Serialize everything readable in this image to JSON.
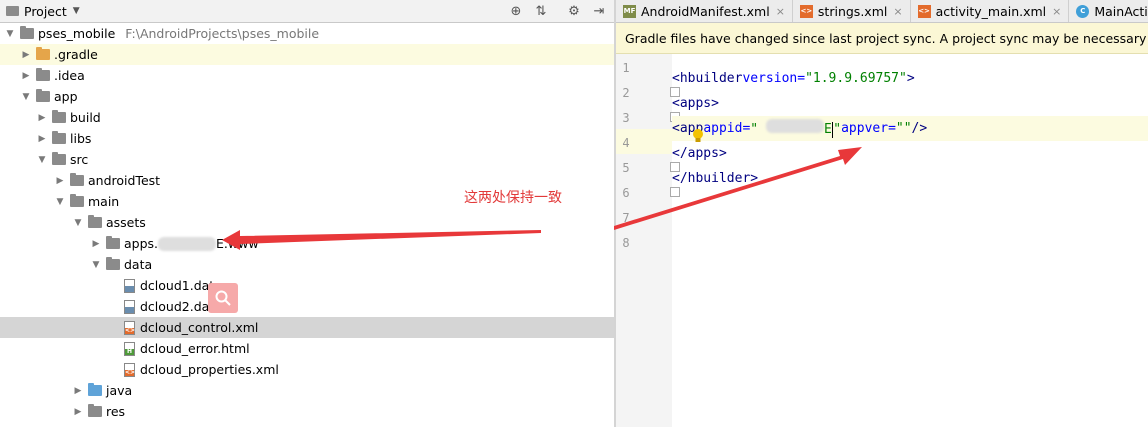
{
  "project_panel": {
    "title": "Project",
    "tools": [
      "target-icon",
      "collapse-icon",
      "gear-icon",
      "hide-icon"
    ]
  },
  "tree": [
    {
      "label": "pses_mobile",
      "path": "F:\\AndroidProjects\\pses_mobile",
      "depth": 0,
      "expanded": true,
      "icon": "module",
      "arrow": true
    },
    {
      "label": ".gradle",
      "depth": 1,
      "expanded": false,
      "icon": "folder-orange",
      "arrow": true
    },
    {
      "label": ".idea",
      "depth": 1,
      "expanded": false,
      "icon": "folder",
      "arrow": true
    },
    {
      "label": "app",
      "depth": 1,
      "expanded": true,
      "icon": "folder-module",
      "arrow": true
    },
    {
      "label": "build",
      "depth": 2,
      "expanded": false,
      "icon": "folder",
      "arrow": true
    },
    {
      "label": "libs",
      "depth": 2,
      "expanded": false,
      "icon": "folder",
      "arrow": true
    },
    {
      "label": "src",
      "depth": 2,
      "expanded": true,
      "icon": "folder",
      "arrow": true
    },
    {
      "label": "androidTest",
      "depth": 3,
      "expanded": false,
      "icon": "folder",
      "arrow": true
    },
    {
      "label": "main",
      "depth": 3,
      "expanded": true,
      "icon": "folder",
      "arrow": true
    },
    {
      "label": "assets",
      "depth": 4,
      "expanded": true,
      "icon": "folder-res",
      "arrow": true
    },
    {
      "label": "apps.",
      "suffix": "E.www",
      "depth": 5,
      "expanded": false,
      "icon": "folder",
      "arrow": true,
      "blurred": true
    },
    {
      "label": "data",
      "depth": 5,
      "expanded": true,
      "icon": "folder",
      "arrow": true
    },
    {
      "label": "dcloud1.dat",
      "depth": 6,
      "icon": "file-dat",
      "arrow": false
    },
    {
      "label": "dcloud2.dat",
      "depth": 6,
      "icon": "file-dat",
      "arrow": false
    },
    {
      "label": "dcloud_control.xml",
      "depth": 6,
      "icon": "file-xml",
      "arrow": false,
      "selected": true
    },
    {
      "label": "dcloud_error.html",
      "depth": 6,
      "icon": "file-html",
      "arrow": false
    },
    {
      "label": "dcloud_properties.xml",
      "depth": 6,
      "icon": "file-xml",
      "arrow": false
    },
    {
      "label": "java",
      "depth": 4,
      "expanded": false,
      "icon": "folder-blue",
      "arrow": true
    },
    {
      "label": "res",
      "depth": 4,
      "expanded": false,
      "icon": "folder-res",
      "arrow": true
    }
  ],
  "tabs": [
    {
      "label": "AndroidManifest.xml",
      "icon": "manifest-icon",
      "tag": "MF",
      "color": "#7f8c49"
    },
    {
      "label": "strings.xml",
      "icon": "xml-icon",
      "tag": "<>",
      "color": "#e36b2c"
    },
    {
      "label": "activity_main.xml",
      "icon": "xml-icon",
      "tag": "<>",
      "color": "#e36b2c"
    },
    {
      "label": "MainActivity.ja",
      "icon": "class-icon",
      "tag": "C",
      "color": "#3f9fd8"
    }
  ],
  "banner": "Gradle files have changed since last project sync. A project sync may be necessary for the",
  "editor": {
    "line_numbers": [
      "1",
      "2",
      "3",
      "4",
      "5",
      "6",
      "7",
      "8"
    ],
    "current_line": 4
  },
  "code": {
    "l2_tag": "hbuilder",
    "l2_attr": "version",
    "l2_val": "1.9.9.69757",
    "l3_tag": "apps",
    "l4_tag": "app",
    "l4_attr1": "appid",
    "l4_val1_tail": "E",
    "l4_attr2": "appver",
    "l4_val2": "",
    "l5_tag": "/apps",
    "l6_tag": "/hbuilder"
  },
  "annotation": "这两处保持一致",
  "colors": {
    "annotation": "#e23a3a",
    "selection": "#d5d5d5",
    "highlight": "#fcfbe0"
  }
}
